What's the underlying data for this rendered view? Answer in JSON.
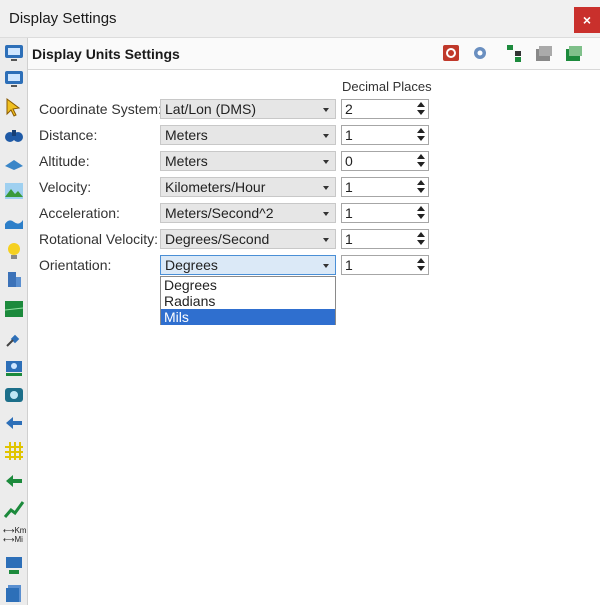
{
  "window": {
    "title": "Display Settings",
    "close_label": "×"
  },
  "panel": {
    "title": "Display Units Settings"
  },
  "columns": {
    "decimal_places": "Decimal Places"
  },
  "rows": [
    {
      "label": "Coordinate System:",
      "unit": "Lat/Lon (DMS)",
      "decimals": "2"
    },
    {
      "label": "Distance:",
      "unit": "Meters",
      "decimals": "1"
    },
    {
      "label": "Altitude:",
      "unit": "Meters",
      "decimals": "0"
    },
    {
      "label": "Velocity:",
      "unit": "Kilometers/Hour",
      "decimals": "1"
    },
    {
      "label": "Acceleration:",
      "unit": "Meters/Second^2",
      "decimals": "1"
    },
    {
      "label": "Rotational Velocity:",
      "unit": "Degrees/Second",
      "decimals": "1"
    },
    {
      "label": "Orientation:",
      "unit": "Degrees",
      "decimals": "1"
    }
  ],
  "orientation_dropdown": {
    "options": [
      "Degrees",
      "Radians",
      "Mils"
    ],
    "highlighted": "Mils"
  },
  "toolbar": {
    "units_label_km": "Km",
    "units_label_mi": "Mi"
  },
  "colors": {
    "accent": "#2f6fcf",
    "close": "#c9302c"
  }
}
